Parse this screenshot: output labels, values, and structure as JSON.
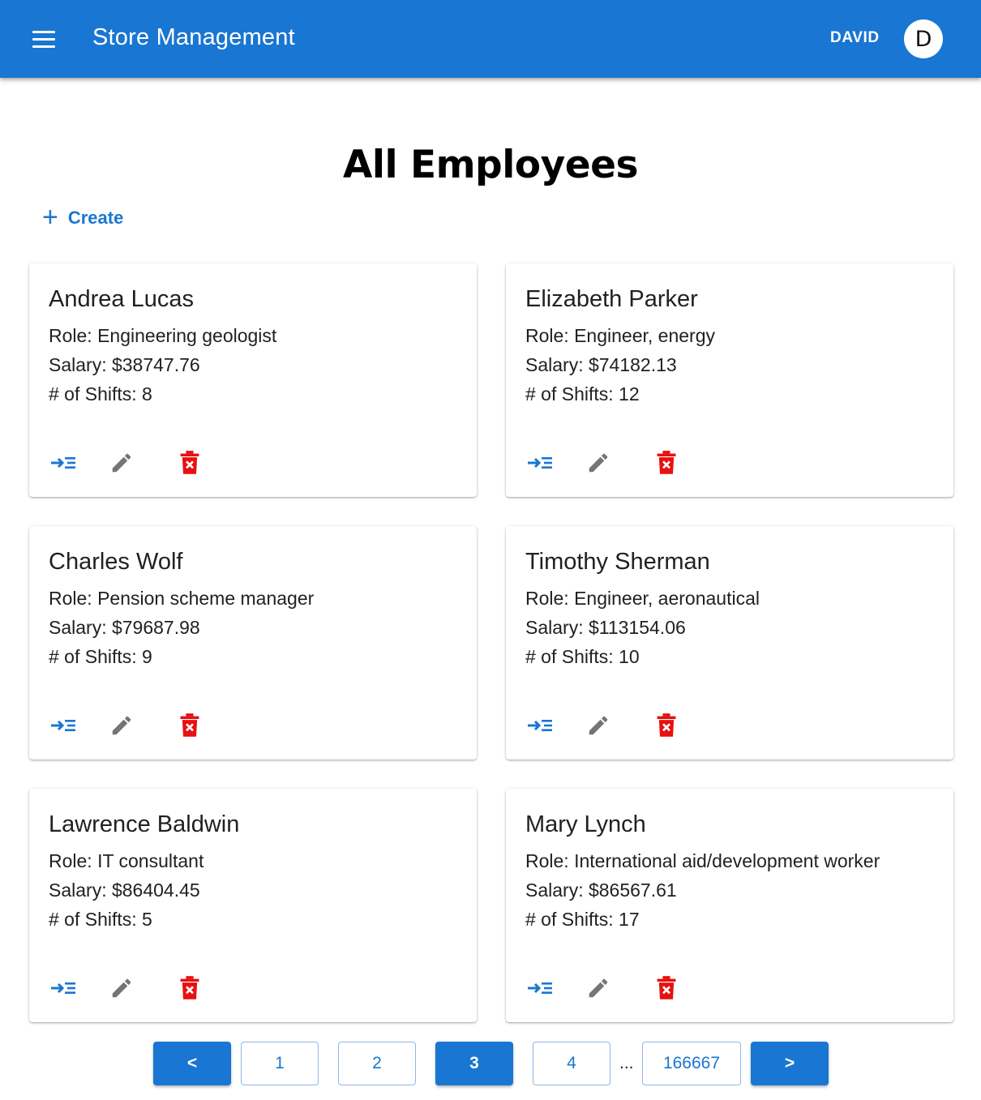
{
  "appbar": {
    "title": "Store Management",
    "user_name": "DAVID",
    "avatar_initial": "D"
  },
  "main": {
    "title": "All Employees",
    "create_label": "Create",
    "create_icon": "+"
  },
  "employees": [
    {
      "name": "Andrea Lucas",
      "role": "Role: Engineering geologist",
      "salary": "Salary: $38747.76",
      "shifts": "# of Shifts: 8"
    },
    {
      "name": "Elizabeth Parker",
      "role": "Role: Engineer, energy",
      "salary": "Salary: $74182.13",
      "shifts": "# of Shifts: 12"
    },
    {
      "name": "Charles Wolf",
      "role": "Role: Pension scheme manager",
      "salary": "Salary: $79687.98",
      "shifts": "# of Shifts: 9"
    },
    {
      "name": "Timothy Sherman",
      "role": "Role: Engineer, aeronautical",
      "salary": "Salary: $113154.06",
      "shifts": "# of Shifts: 10"
    },
    {
      "name": "Lawrence Baldwin",
      "role": "Role: IT consultant",
      "salary": "Salary: $86404.45",
      "shifts": "# of Shifts: 5"
    },
    {
      "name": "Mary Lynch",
      "role": "Role: International aid/development worker",
      "salary": "Salary: $86567.61",
      "shifts": "# of Shifts: 17"
    }
  ],
  "icons": {
    "assign": "assign-shift-icon",
    "edit": "pencil-icon",
    "delete": "trash-icon"
  },
  "colors": {
    "primary": "#1976d2",
    "edit": "#757575",
    "delete": "#e81010"
  },
  "pagination": {
    "prev": "<",
    "pages": [
      "1",
      "2",
      "3",
      "4"
    ],
    "current": "3",
    "ellipsis": "...",
    "last": "166667",
    "next": ">"
  }
}
